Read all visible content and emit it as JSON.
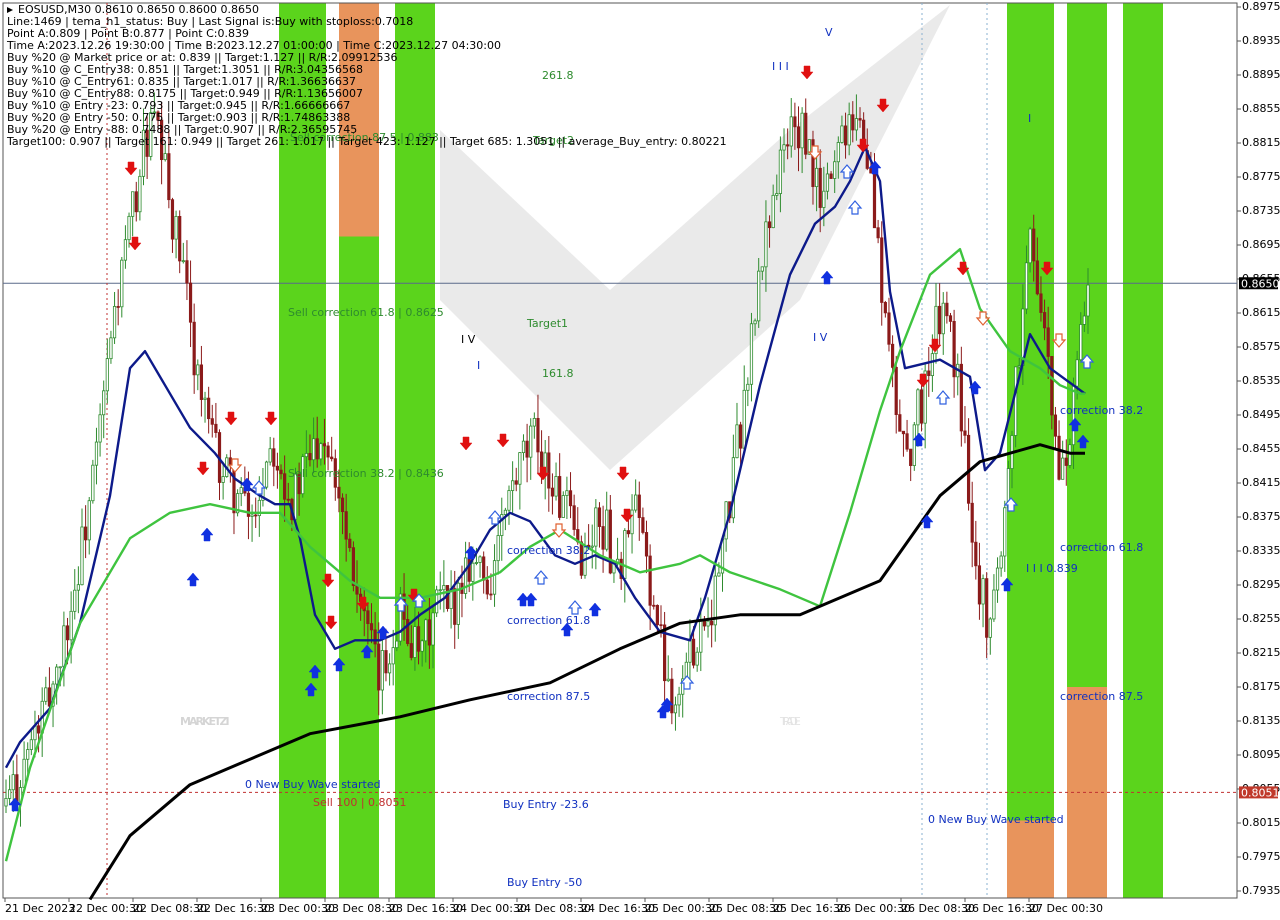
{
  "header": {
    "symbol_line": "EOSUSD,M30  0.8610 0.8650 0.8600 0.8650",
    "info_lines": [
      "Line:1469 | tema_h1_status: Buy | Last Signal is:Buy with stoploss:0.7018",
      "Point A:0.809 | Point B:0.877 | Point C:0.839",
      "Time A:2023.12.26 19:30:00 | Time B:2023.12.27 01:00:00 | Time C:2023.12.27 04:30:00",
      "Buy %20 @ Market price or at: 0.839 || Target:1.127 || R/R:2.09912536",
      "Buy %10 @ C_Entry38: 0.851 || Target:1.3051 || R/R:3.04356568",
      "Buy %10 @ C_Entry61: 0.835 || Target:1.017 || R/R:1.36636637",
      "Buy %10 @ C_Entry88: 0.8175 || Target:0.949 || R/R:1.13656007",
      "Buy %10 @ Entry -23: 0.793 || Target:0.945 || R/R:1.66666667",
      "Buy %20 @ Entry -50: 0.775 || Target:0.903 || R/R:1.74863388",
      "Buy %20 @ Entry -88: 0.7488 || Target:0.907 || R/R:2.36595745",
      "Target100: 0.907 || Target 161: 0.949 || Target 261: 1.017 || Target 423: 1.127 || Target 685: 1.3051 || average_Buy_entry: 0.80221"
    ]
  },
  "watermark": {
    "left": "MARKETZI",
    "right": "TRADE"
  },
  "chart_data": {
    "type": "candlestick",
    "symbol": "EOSUSD",
    "timeframe": "M30",
    "ylim": [
      0.7925,
      0.8985
    ],
    "y_ticks": [
      "0.8975",
      "0.8935",
      "0.8895",
      "0.8855",
      "0.8815",
      "0.8775",
      "0.8735",
      "0.8695",
      "0.8655",
      "0.8615",
      "0.8575",
      "0.8535",
      "0.8495",
      "0.8455",
      "0.8415",
      "0.8375",
      "0.8335",
      "0.8295",
      "0.8255",
      "0.8215",
      "0.8175",
      "0.8135",
      "0.8095",
      "0.8055",
      "0.8015",
      "0.7975",
      "0.7935"
    ],
    "x_ticks": [
      "21 Dec 2023",
      "22 Dec 00:30",
      "22 Dec 08:30",
      "22 Dec 16:30",
      "23 Dec 00:30",
      "23 Dec 08:30",
      "23 Dec 16:30",
      "24 Dec 00:30",
      "24 Dec 08:30",
      "24 Dec 16:30",
      "25 Dec 00:30",
      "25 Dec 08:30",
      "25 Dec 16:30",
      "26 Dec 00:30",
      "26 Dec 08:30",
      "26 Dec 16:30",
      "27 Dec 00:30"
    ],
    "current_price": "0.8650",
    "sell_level": "0.8051",
    "close_path": [
      0.8035,
      0.806,
      0.809,
      0.812,
      0.815,
      0.819,
      0.824,
      0.829,
      0.836,
      0.843,
      0.852,
      0.861,
      0.868,
      0.874,
      0.881,
      0.884,
      0.879,
      0.872,
      0.866,
      0.858,
      0.851,
      0.846,
      0.843,
      0.841,
      0.839,
      0.837,
      0.842,
      0.847,
      0.844,
      0.839,
      0.842,
      0.845,
      0.848,
      0.846,
      0.84,
      0.834,
      0.828,
      0.822,
      0.818,
      0.822,
      0.827,
      0.824,
      0.82,
      0.824,
      0.828,
      0.826,
      0.829,
      0.833,
      0.832,
      0.829,
      0.834,
      0.839,
      0.842,
      0.845,
      0.847,
      0.843,
      0.84,
      0.838,
      0.834,
      0.833,
      0.837,
      0.836,
      0.831,
      0.834,
      0.838,
      0.833,
      0.826,
      0.82,
      0.816,
      0.819,
      0.823,
      0.826,
      0.828,
      0.835,
      0.843,
      0.851,
      0.86,
      0.869,
      0.876,
      0.88,
      0.884,
      0.882,
      0.878,
      0.874,
      0.879,
      0.883,
      0.886,
      0.883,
      0.876,
      0.865,
      0.854,
      0.847,
      0.846,
      0.851,
      0.856,
      0.862,
      0.859,
      0.851,
      0.84,
      0.829,
      0.825,
      0.832,
      0.845,
      0.858,
      0.87,
      0.866,
      0.853,
      0.842,
      0.846,
      0.855,
      0.865
    ],
    "indicators": [
      {
        "name": "navy",
        "color": "#0d1a8a",
        "values": [
          0.808,
          0.811,
          0.815,
          0.825,
          0.84,
          0.855,
          0.857,
          0.853,
          0.848,
          0.845,
          0.842,
          0.84,
          0.839,
          0.839,
          0.835,
          0.826,
          0.822,
          0.823,
          0.823,
          0.824,
          0.826,
          0.828,
          0.832,
          0.836,
          0.838,
          0.837,
          0.833,
          0.832,
          0.833,
          0.832,
          0.828,
          0.824,
          0.823,
          0.828,
          0.838,
          0.853,
          0.866,
          0.872,
          0.874,
          0.877,
          0.881,
          0.877,
          0.864,
          0.855,
          0.856,
          0.854,
          0.843,
          0.845,
          0.859,
          0.855,
          0.852
        ]
      },
      {
        "name": "green",
        "color": "#3fc43f",
        "values": [
          0.797,
          0.808,
          0.825,
          0.835,
          0.838,
          0.839,
          0.838,
          0.838,
          0.834,
          0.83,
          0.828,
          0.828,
          0.829,
          0.831,
          0.834,
          0.836,
          0.833,
          0.831,
          0.832,
          0.833,
          0.831,
          0.829,
          0.827,
          0.838,
          0.85,
          0.857,
          0.866,
          0.869,
          0.862,
          0.857,
          0.855,
          0.853,
          0.852,
          0.852
        ]
      },
      {
        "name": "black",
        "color": "#000000",
        "values": [
          0.7925,
          0.8,
          0.806,
          0.809,
          0.812,
          0.814,
          0.816,
          0.818,
          0.822,
          0.825,
          0.826,
          0.826,
          0.83,
          0.84,
          0.844,
          0.845,
          0.846,
          0.845,
          0.845
        ]
      }
    ],
    "label_texts": {
      "sell_corr_875": "Sell correction 87.5 | 0.883",
      "sell_corr_618": "Sell correction 61.8 | 0.8625",
      "sell_corr_382": "Sell correction 38.2 | 0.8436",
      "new_buy_wave_1": "0 New Buy Wave started",
      "sell_100": "Sell 100 | 0.8051",
      "buy_entry_236": "Buy Entry -23.6",
      "buy_entry_50": "Buy Entry -50",
      "correction_382_mid": "correction 38.2",
      "correction_618_mid": "correction 61.8",
      "correction_875_mid": "correction 87.5",
      "target2": "Target2",
      "target1": "Target1",
      "fib_2618": "261.8",
      "fib_1618": "161.8",
      "wave_iv_left": "I V",
      "wave_i_left": "I",
      "wave_iii_top": "I I I",
      "wave_v_top": "V",
      "wave_iv_right": "I V",
      "wave_i_right": "I",
      "wave_iii_right": "I I I 0.839",
      "correction_382_right": "correction 38.2",
      "correction_618_right": "correction 61.8",
      "correction_875_right": "correction 87.5",
      "new_buy_wave_2": "0 New Buy Wave started"
    }
  }
}
